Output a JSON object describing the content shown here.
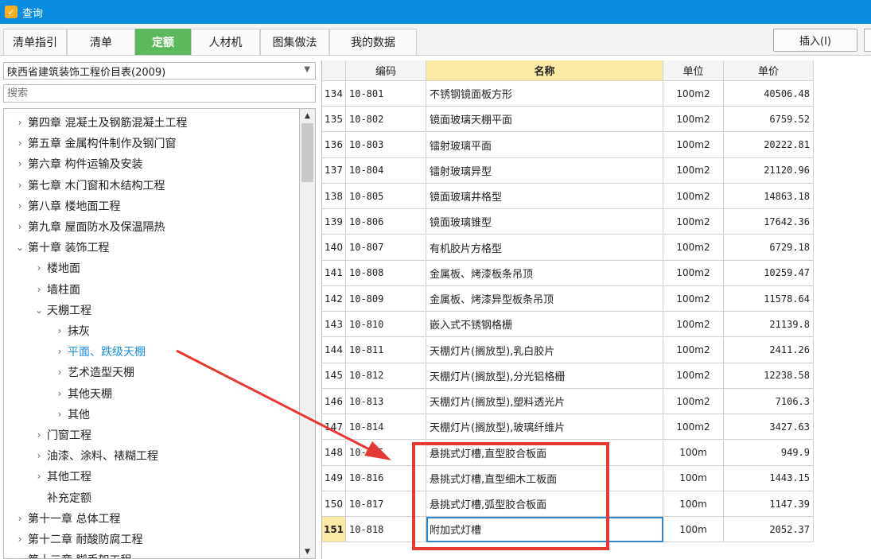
{
  "window": {
    "title": "查询"
  },
  "tabs": [
    {
      "label": "清单指引",
      "active": false
    },
    {
      "label": "清单",
      "active": false
    },
    {
      "label": "定额",
      "active": true
    },
    {
      "label": "人材机",
      "active": false
    },
    {
      "label": "图集做法",
      "active": false
    },
    {
      "label": "我的数据",
      "active": false
    }
  ],
  "toolbar": {
    "insert_label": "插入(I)"
  },
  "library": {
    "selected": "陕西省建筑装饰工程价目表(2009)"
  },
  "search": {
    "placeholder": "搜索"
  },
  "tree": [
    {
      "label": "第四章 混凝土及钢筋混凝土工程",
      "expanded": false,
      "level": 0
    },
    {
      "label": "第五章 金属构件制作及钢门窗",
      "expanded": false,
      "level": 0
    },
    {
      "label": "第六章 构件运输及安装",
      "expanded": false,
      "level": 0
    },
    {
      "label": "第七章 木门窗和木结构工程",
      "expanded": false,
      "level": 0
    },
    {
      "label": "第八章 楼地面工程",
      "expanded": false,
      "level": 0
    },
    {
      "label": "第九章 屋面防水及保温隔热",
      "expanded": false,
      "level": 0
    },
    {
      "label": "第十章 装饰工程",
      "expanded": true,
      "level": 0
    },
    {
      "label": "楼地面",
      "expanded": false,
      "level": 1
    },
    {
      "label": "墙柱面",
      "expanded": false,
      "level": 1
    },
    {
      "label": "天棚工程",
      "expanded": true,
      "level": 1
    },
    {
      "label": "抹灰",
      "expanded": false,
      "level": 2
    },
    {
      "label": "平面、跌级天棚",
      "expanded": false,
      "level": 2,
      "selected": true
    },
    {
      "label": "艺术造型天棚",
      "expanded": false,
      "level": 2
    },
    {
      "label": "其他天棚",
      "expanded": false,
      "level": 2
    },
    {
      "label": "其他",
      "expanded": false,
      "level": 2
    },
    {
      "label": "门窗工程",
      "expanded": false,
      "level": 1
    },
    {
      "label": "油漆、涂料、裱糊工程",
      "expanded": false,
      "level": 1
    },
    {
      "label": "其他工程",
      "expanded": false,
      "level": 1
    },
    {
      "label": "补充定额",
      "expanded": null,
      "level": 1
    },
    {
      "label": "第十一章 总体工程",
      "expanded": false,
      "level": 0
    },
    {
      "label": "第十二章 耐酸防腐工程",
      "expanded": false,
      "level": 0
    },
    {
      "label": "第十三章 脚手架工程",
      "expanded": false,
      "level": 0
    }
  ],
  "table": {
    "columns": [
      "",
      "编码",
      "名称",
      "单位",
      "单价"
    ],
    "rows": [
      {
        "no": "134",
        "code": "10-801",
        "name": "不锈钢镜面板方形",
        "unit": "100m2",
        "price": "40506.48"
      },
      {
        "no": "135",
        "code": "10-802",
        "name": "镜面玻璃天棚平面",
        "unit": "100m2",
        "price": "6759.52"
      },
      {
        "no": "136",
        "code": "10-803",
        "name": "镭射玻璃平面",
        "unit": "100m2",
        "price": "20222.81"
      },
      {
        "no": "137",
        "code": "10-804",
        "name": "镭射玻璃异型",
        "unit": "100m2",
        "price": "21120.96"
      },
      {
        "no": "138",
        "code": "10-805",
        "name": "镜面玻璃井格型",
        "unit": "100m2",
        "price": "14863.18"
      },
      {
        "no": "139",
        "code": "10-806",
        "name": "镜面玻璃锥型",
        "unit": "100m2",
        "price": "17642.36"
      },
      {
        "no": "140",
        "code": "10-807",
        "name": "有机胶片方格型",
        "unit": "100m2",
        "price": "6729.18"
      },
      {
        "no": "141",
        "code": "10-808",
        "name": "金属板、烤漆板条吊顶",
        "unit": "100m2",
        "price": "10259.47"
      },
      {
        "no": "142",
        "code": "10-809",
        "name": "金属板、烤漆异型板条吊顶",
        "unit": "100m2",
        "price": "11578.64"
      },
      {
        "no": "143",
        "code": "10-810",
        "name": "嵌入式不锈钢格栅",
        "unit": "100m2",
        "price": "21139.8"
      },
      {
        "no": "144",
        "code": "10-811",
        "name": "天棚灯片(搁放型),乳白胶片",
        "unit": "100m2",
        "price": "2411.26"
      },
      {
        "no": "145",
        "code": "10-812",
        "name": "天棚灯片(搁放型),分光铝格栅",
        "unit": "100m2",
        "price": "12238.58"
      },
      {
        "no": "146",
        "code": "10-813",
        "name": "天棚灯片(搁放型),塑料透光片",
        "unit": "100m2",
        "price": "7106.3"
      },
      {
        "no": "147",
        "code": "10-814",
        "name": "天棚灯片(搁放型),玻璃纤维片",
        "unit": "100m2",
        "price": "3427.63"
      },
      {
        "no": "148",
        "code": "10-815",
        "name": "悬挑式灯槽,直型胶合板面",
        "unit": "100m",
        "price": "949.9"
      },
      {
        "no": "149",
        "code": "10-816",
        "name": "悬挑式灯槽,直型细木工板面",
        "unit": "100m",
        "price": "1443.15"
      },
      {
        "no": "150",
        "code": "10-817",
        "name": "悬挑式灯槽,弧型胶合板面",
        "unit": "100m",
        "price": "1147.39"
      },
      {
        "no": "151",
        "code": "10-818",
        "name": "附加式灯槽",
        "unit": "100m",
        "price": "2052.37",
        "current": true
      }
    ]
  },
  "colors": {
    "titlebar": "#0a8de0",
    "active_tab": "#5cb85c",
    "annotation": "#e53935",
    "selected_tree": "#1a8fe0",
    "header_sorted": "#fbe9a6"
  }
}
